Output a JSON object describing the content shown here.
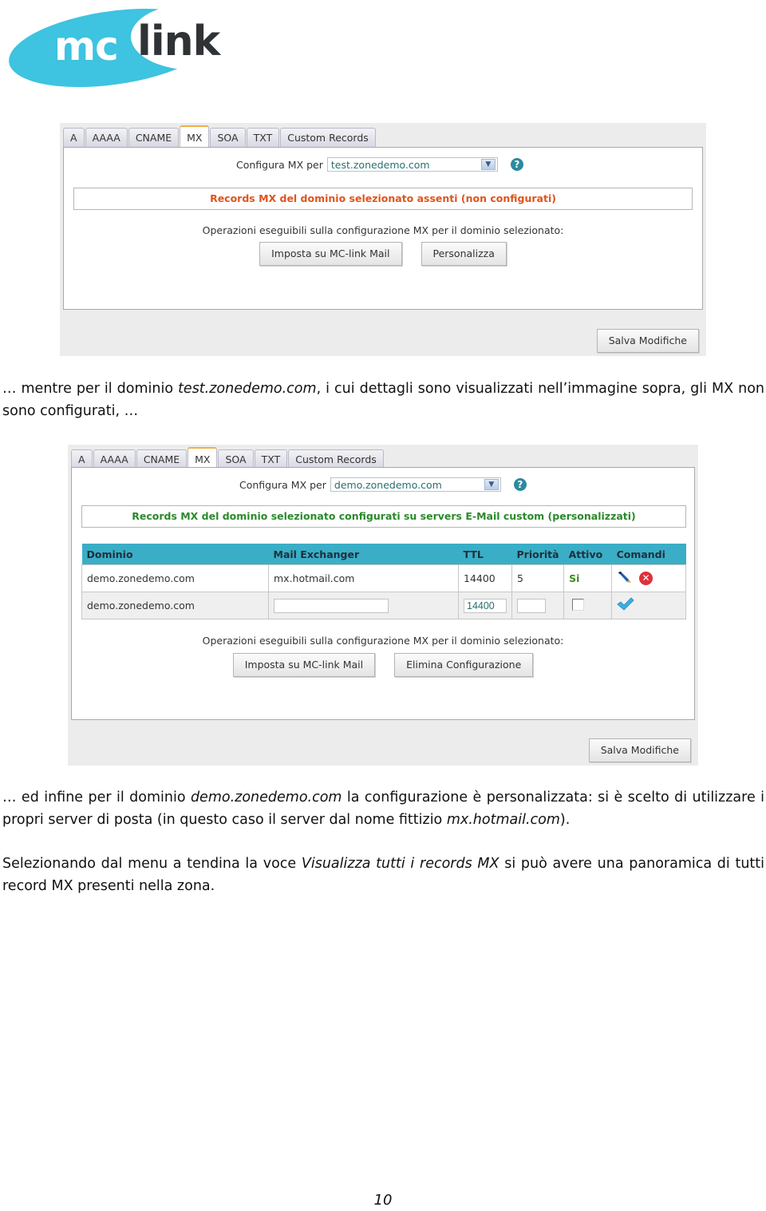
{
  "logo": {
    "part1": "mc",
    "part2": "link"
  },
  "colors": {
    "brand_cyan": "#3ec3e0",
    "warning_text": "#e0531c",
    "success_text": "#2a8a2a",
    "table_header": "#3aaec7",
    "active_tab_accent": "#f0b040"
  },
  "screenshot1": {
    "tabs": [
      "A",
      "AAAA",
      "CNAME",
      "MX",
      "SOA",
      "TXT",
      "Custom Records"
    ],
    "active_tab": "MX",
    "config_label": "Configura MX per",
    "domain_select_value": "test.zonedemo.com",
    "help_icon": "?",
    "status_message": "Records MX del dominio selezionato assenti (non configurati)",
    "operations_label": "Operazioni eseguibili sulla configurazione MX per il dominio selezionato:",
    "buttons": [
      "Imposta su MC-link Mail",
      "Personalizza"
    ],
    "save_label": "Salva Modifiche"
  },
  "paragraph1": {
    "before": "… mentre per il dominio ",
    "italic": "test.zonedemo.com",
    "after": ", i cui dettagli sono visualizzati nell’immagine sopra, gli MX non sono configurati, …"
  },
  "screenshot2": {
    "tabs": [
      "A",
      "AAAA",
      "CNAME",
      "MX",
      "SOA",
      "TXT",
      "Custom Records"
    ],
    "active_tab": "MX",
    "config_label": "Configura MX per",
    "domain_select_value": "demo.zonedemo.com",
    "help_icon": "?",
    "status_message": "Records MX del dominio selezionato configurati su servers E-Mail custom (personalizzati)",
    "table": {
      "headers": [
        "Dominio",
        "Mail Exchanger",
        "TTL",
        "Priorità",
        "Attivo",
        "Comandi"
      ],
      "rows": [
        {
          "dominio": "demo.zonedemo.com",
          "mail_exchanger": "mx.hotmail.com",
          "ttl": "14400",
          "priorita": "5",
          "attivo": "Si",
          "commands": [
            "edit-icon",
            "delete-icon"
          ]
        }
      ],
      "new_row": {
        "dominio": "demo.zonedemo.com",
        "mail_exchanger": "",
        "ttl": "14400",
        "priorita": "",
        "attivo_checked": false,
        "commands": [
          "confirm-icon"
        ]
      }
    },
    "operations_label": "Operazioni eseguibili sulla configurazione MX per il dominio selezionato:",
    "buttons": [
      "Imposta su MC-link Mail",
      "Elimina Configurazione"
    ],
    "save_label": "Salva Modifiche"
  },
  "paragraph2": {
    "p1": "… ed infine per il dominio ",
    "i1": "demo.zonedemo.com",
    "p2": " la configurazione è personalizzata: si è scelto di utilizzare i propri server di posta (in questo caso il server dal nome fittizio ",
    "i2": "mx.hotmail.com",
    "p3": ")."
  },
  "paragraph3": {
    "p1": "Selezionando dal menu a tendina la voce ",
    "i1": "Visualizza tutti i records MX",
    "p2": " si può avere una panoramica di tutti record MX presenti nella zona."
  },
  "page_number": "10"
}
